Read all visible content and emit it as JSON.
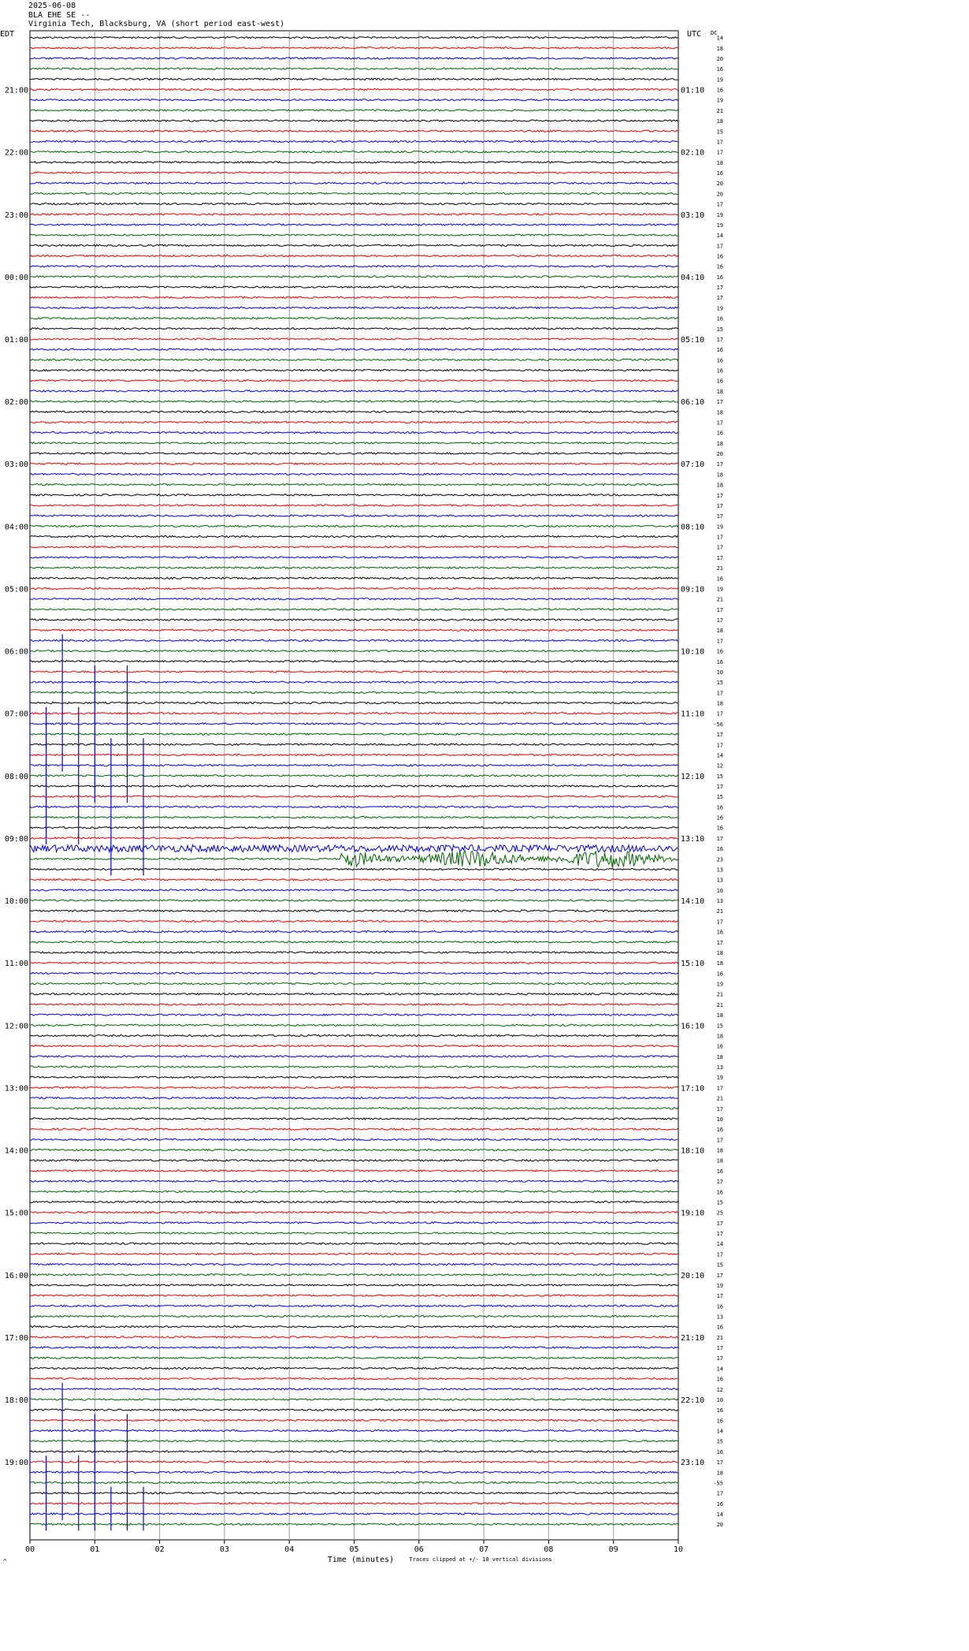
{
  "header": {
    "date": "2025-06-08",
    "station": "BLA EHE SE --",
    "location": "Virginia Tech, Blacksburg, VA (short period east-west)"
  },
  "corner": {
    "left_tz": "EDT",
    "right_tz": "UTC",
    "dc_label": "DC"
  },
  "footer": {
    "xlabel": "Time (minutes)",
    "clip_note": "Traces clipped at +/- 10 vertical divisions",
    "corner_mark": "^"
  },
  "colors": {
    "cycle": [
      "#000000",
      "#ff0000",
      "#0000ff",
      "#006400"
    ],
    "grid": "#a0a0a0"
  },
  "chart_data": {
    "type": "line",
    "subtype": "helicorder",
    "x_range": [
      0,
      10
    ],
    "x_ticks": [
      "00",
      "01",
      "02",
      "03",
      "04",
      "05",
      "06",
      "07",
      "08",
      "09",
      "10"
    ],
    "rows_per_hour": 6,
    "left_hour_labels": [
      "21:00",
      "22:00",
      "23:00",
      "00:00",
      "01:00",
      "02:00",
      "03:00",
      "04:00",
      "05:00",
      "06:00",
      "07:00",
      "08:00",
      "09:00",
      "10:00",
      "11:00",
      "12:00",
      "13:00",
      "14:00",
      "15:00",
      "16:00",
      "17:00",
      "18:00",
      "19:00"
    ],
    "right_hour_labels": [
      "01:10",
      "02:10",
      "03:10",
      "04:10",
      "05:10",
      "06:10",
      "07:10",
      "08:10",
      "09:10",
      "10:10",
      "11:10",
      "12:10",
      "13:10",
      "14:10",
      "15:10",
      "16:10",
      "17:10",
      "18:10",
      "19:10",
      "20:10",
      "21:10",
      "22:10",
      "23:10"
    ],
    "dc_offsets": [
      "14",
      "18",
      "20",
      "16",
      "19",
      "16",
      "19",
      "21",
      "18",
      "15",
      "17",
      "17",
      "18",
      "16",
      "20",
      "20",
      "17",
      "19",
      "19",
      "14",
      "17",
      "16",
      "16",
      "16",
      "17",
      "17",
      "19",
      "16",
      "15",
      "17",
      "16",
      "16",
      "16",
      "16",
      "18",
      "17",
      "18",
      "17",
      "16",
      "18",
      "20",
      "17",
      "18",
      "18",
      "17",
      "17",
      "17",
      "19",
      "17",
      "17",
      "17",
      "21",
      "16",
      "19",
      "21",
      "17",
      "17",
      "18",
      "17",
      "16",
      "16",
      "10",
      "15",
      "17",
      "18",
      "17",
      "-56",
      "17",
      "17",
      "14",
      "12",
      "15",
      "17",
      "15",
      "16",
      "16",
      "16",
      "17",
      "16",
      "23",
      "13",
      "13",
      "10",
      "13",
      "21",
      "17",
      "16",
      "17",
      "18",
      "18",
      "16",
      "19",
      "21",
      "21",
      "18",
      "15",
      "18",
      "16",
      "18",
      "13",
      "19",
      "17",
      "21",
      "17",
      "10",
      "16",
      "17",
      "18",
      "18",
      "16",
      "17",
      "16",
      "15",
      "25",
      "17",
      "17",
      "14",
      "17",
      "15",
      "17",
      "19",
      "17",
      "16",
      "13",
      "16",
      "21",
      "17",
      "17",
      "14",
      "16",
      "12",
      "10",
      "16",
      "16",
      "14",
      "15",
      "16",
      "17",
      "18",
      "-55",
      "17",
      "16",
      "14",
      "20"
    ],
    "events": [
      {
        "kind": "teleseism",
        "trace_index": 79,
        "start_min": 4.8,
        "end_min": 10,
        "color": "#006400"
      },
      {
        "kind": "teleseism",
        "trace_index": 78,
        "start_min": 0,
        "end_min": 10,
        "color": "#000000"
      },
      {
        "kind": "spike_burst",
        "trace_start": 58,
        "trace_end": 78,
        "times_min": [
          0,
          0.25,
          0.5,
          0.75,
          1.0,
          1.25,
          1.5,
          1.75
        ]
      },
      {
        "kind": "spike_burst",
        "trace_start": 130,
        "trace_end": 146,
        "times_min": [
          0,
          0.25,
          0.5,
          0.75,
          1.0,
          1.25,
          1.5,
          1.75
        ]
      }
    ]
  }
}
